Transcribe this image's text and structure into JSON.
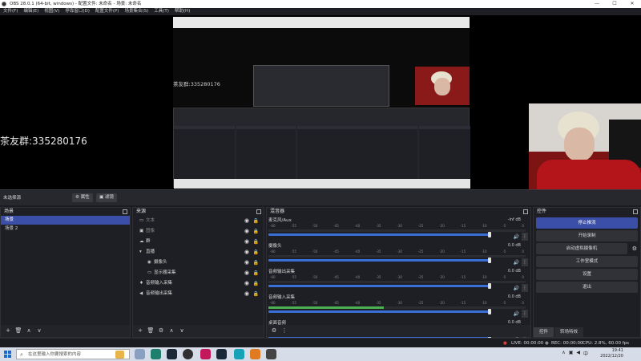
{
  "window": {
    "title": "OBS 28.0.1 (64-bit, windows) - 配置文件: 未命名 - 场景: 未命名",
    "min": "—",
    "max": "☐",
    "close": "✕"
  },
  "menu": [
    "文件(F)",
    "编辑(E)",
    "视图(V)",
    "停靠窗口(D)",
    "配置文件(P)",
    "场景集合(S)",
    "工具(T)",
    "帮助(H)"
  ],
  "preview": {
    "group_text": "茶友群:335280176"
  },
  "controls_bar": {
    "source_status": "未选择源",
    "properties": "属性",
    "filters": "滤镜"
  },
  "scenes": {
    "title": "场景",
    "items": [
      {
        "label": "场景",
        "selected": true
      },
      {
        "label": "场景 2",
        "selected": false
      }
    ]
  },
  "sources": {
    "title": "来源",
    "items": [
      {
        "icon": "monitor-icon",
        "glyph": "▭",
        "label": "文本",
        "dim": true,
        "indent": false
      },
      {
        "icon": "image-icon",
        "glyph": "▣",
        "label": "图像",
        "dim": true,
        "indent": false
      },
      {
        "icon": "bird-icon",
        "glyph": "☁",
        "label": "群",
        "dim": false,
        "indent": false
      },
      {
        "icon": "folder-icon",
        "glyph": "▾",
        "label": "直播",
        "dim": false,
        "indent": false
      },
      {
        "icon": "camera-icon",
        "glyph": "◉",
        "label": "摄像头",
        "dim": false,
        "indent": true
      },
      {
        "icon": "display-icon",
        "glyph": "▭",
        "label": "显示器采集",
        "dim": false,
        "indent": true
      },
      {
        "icon": "mic-icon",
        "glyph": "♦",
        "label": "音频输入采集",
        "dim": false,
        "indent": false
      },
      {
        "icon": "speaker-icon",
        "glyph": "◀",
        "label": "音频输出采集",
        "dim": false,
        "indent": false
      }
    ]
  },
  "mixer": {
    "title": "混音器",
    "scale": [
      "-60",
      "-55",
      "-50",
      "-45",
      "-40",
      "-35",
      "-30",
      "-25",
      "-20",
      "-15",
      "-10",
      "-5",
      "0"
    ],
    "channels": [
      {
        "name": "麦克风/Aux",
        "db": "-inf dB",
        "level": 0,
        "volume": 0.86
      },
      {
        "name": "摄像头",
        "db": "0.0 dB",
        "level": 0,
        "volume": 0.86
      },
      {
        "name": "音频输出采集",
        "db": "0.0 dB",
        "level": 0,
        "volume": 0.86
      },
      {
        "name": "音频输入采集",
        "db": "0.0 dB",
        "level": 0.45,
        "volume": 0.86
      },
      {
        "name": "桌面音频",
        "db": "0.0 dB",
        "level": 0,
        "volume": 0.86
      }
    ]
  },
  "controls": {
    "title": "控件",
    "buttons": [
      "停止推流",
      "开始录制",
      "启动虚拟摄像机",
      "工作室模式",
      "设置",
      "退出"
    ],
    "tabs": [
      "控件",
      "转场特效"
    ]
  },
  "status": {
    "live": "LIVE: 00:00:00",
    "rec": "REC: 00:00:00",
    "cpu": "CPU: 2.8%, 60.00 fps"
  },
  "taskbar": {
    "search_placeholder": "在这里输入你要搜索的内容",
    "time": "19:41",
    "date": "2022/12/20",
    "lang": "中"
  },
  "colors": {
    "accent": "#3c4fa8",
    "panel": "#1e1f24",
    "meter_green": "#4caf50",
    "slider_blue": "#3b6fd8"
  }
}
